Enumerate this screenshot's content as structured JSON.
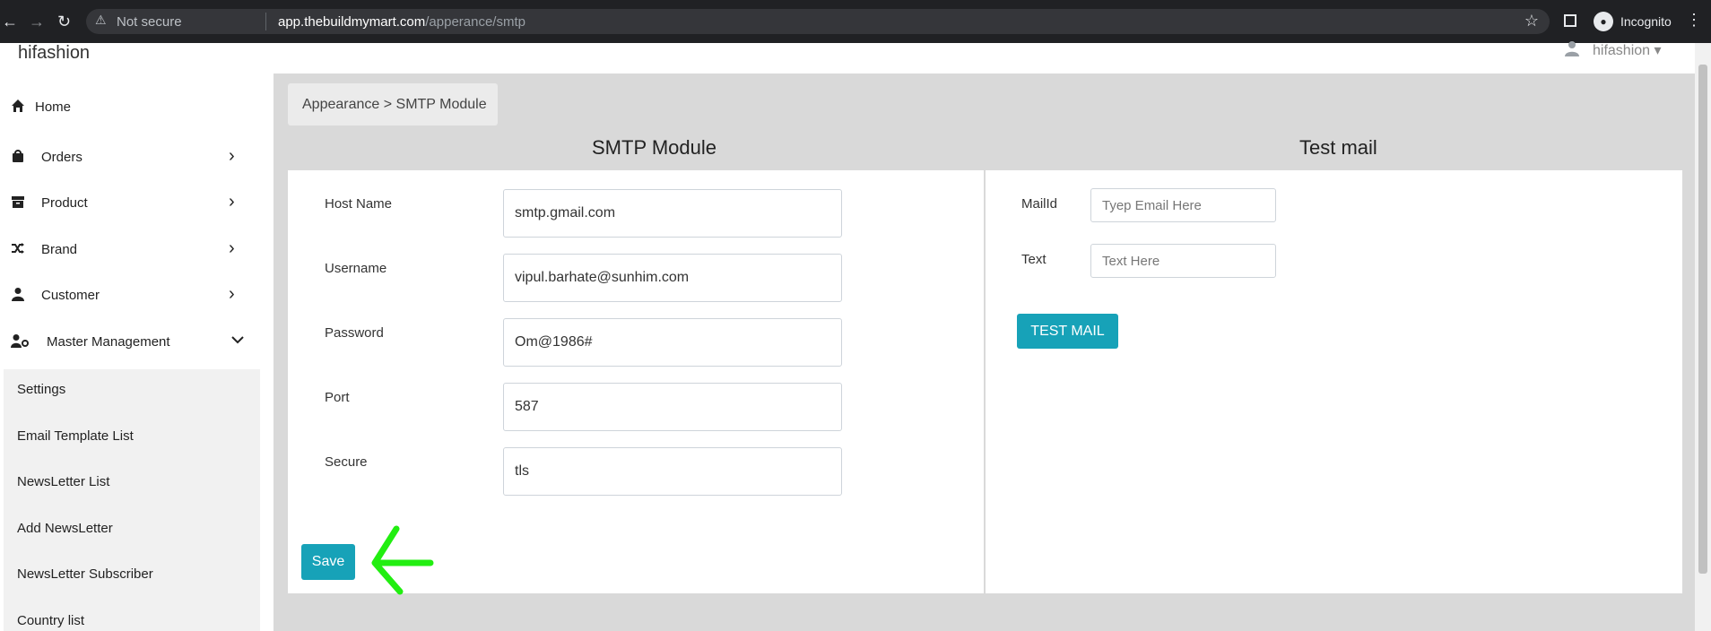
{
  "browser": {
    "security_label": "Not secure",
    "url_domain": "app.thebuildmymart.com",
    "url_path": "/apperance/smtp",
    "profile_label": "Incognito"
  },
  "topbar": {
    "brand": "hifashion",
    "user": "hifashion ▾"
  },
  "sidebar": {
    "items": [
      {
        "label": "Home",
        "icon": "home-icon"
      },
      {
        "label": "Orders",
        "icon": "bag-icon"
      },
      {
        "label": "Product",
        "icon": "archive-icon"
      },
      {
        "label": "Brand",
        "icon": "shuffle-icon"
      },
      {
        "label": "Customer",
        "icon": "user-icon"
      },
      {
        "label": "Master Management",
        "icon": "user-gear-icon"
      }
    ],
    "submenu": [
      "Settings",
      "Email Template List",
      "NewsLetter List",
      "Add NewsLetter",
      "NewsLetter Subscriber",
      "Country list"
    ]
  },
  "breadcrumb": "Appearance > SMTP Module",
  "smtp": {
    "title": "SMTP Module",
    "fields": [
      {
        "label": "Host Name",
        "value": "smtp.gmail.com"
      },
      {
        "label": "Username",
        "value": "vipul.barhate@sunhim.com"
      },
      {
        "label": "Password",
        "value": "Om@1986#"
      },
      {
        "label": "Port",
        "value": "587"
      },
      {
        "label": "Secure",
        "value": "tls"
      }
    ],
    "save_label": "Save"
  },
  "test_mail": {
    "title": "Test mail",
    "mail_label": "MailId",
    "mail_placeholder": "Tyep Email Here",
    "text_label": "Text",
    "text_placeholder": "Text Here",
    "button_label": "TEST MAIL"
  },
  "colors": {
    "accent": "#17a2b8",
    "annotation_arrow": "#22ee11"
  }
}
